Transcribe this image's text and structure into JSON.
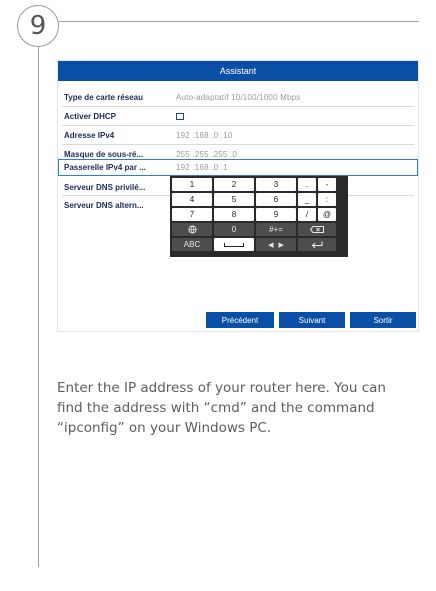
{
  "step": {
    "number": "9"
  },
  "dialog": {
    "title": "Assistant",
    "fields": [
      {
        "label": "Type de carte réseau",
        "value": "Auto-adaptatif 10/100/1000 Mbps"
      },
      {
        "label": "Activer DHCP",
        "checked": false
      },
      {
        "label": "Adresse IPv4",
        "value": "192 .168 .0    .10"
      },
      {
        "label": "Masque de sous-ré...",
        "value": "255 .255 .255 .0"
      },
      {
        "label": "Passerelle IPv4 par ...",
        "value": "192 .168 .0    .1"
      },
      {
        "label": "Serveur DNS privilé..."
      },
      {
        "label": "Serveur DNS altern..."
      }
    ],
    "keyboard": {
      "keys": [
        "1",
        "2",
        "3",
        ".",
        "-",
        "4",
        "5",
        "6",
        "_",
        ":",
        "7",
        "8",
        "9",
        "/",
        "@",
        "0",
        "#+=",
        "ABC"
      ]
    },
    "buttons": {
      "previous": "Précédent",
      "next": "Suivant",
      "exit": "Sortir"
    }
  },
  "caption": "Enter the IP address of your router here. You can find the address with “cmd” and the command “ipconfig” on your Windows PC.",
  "colors": {
    "titlebar": "#0a4fa6",
    "button": "#0a4fa6",
    "keyboard_bg": "#2a2a2a"
  }
}
